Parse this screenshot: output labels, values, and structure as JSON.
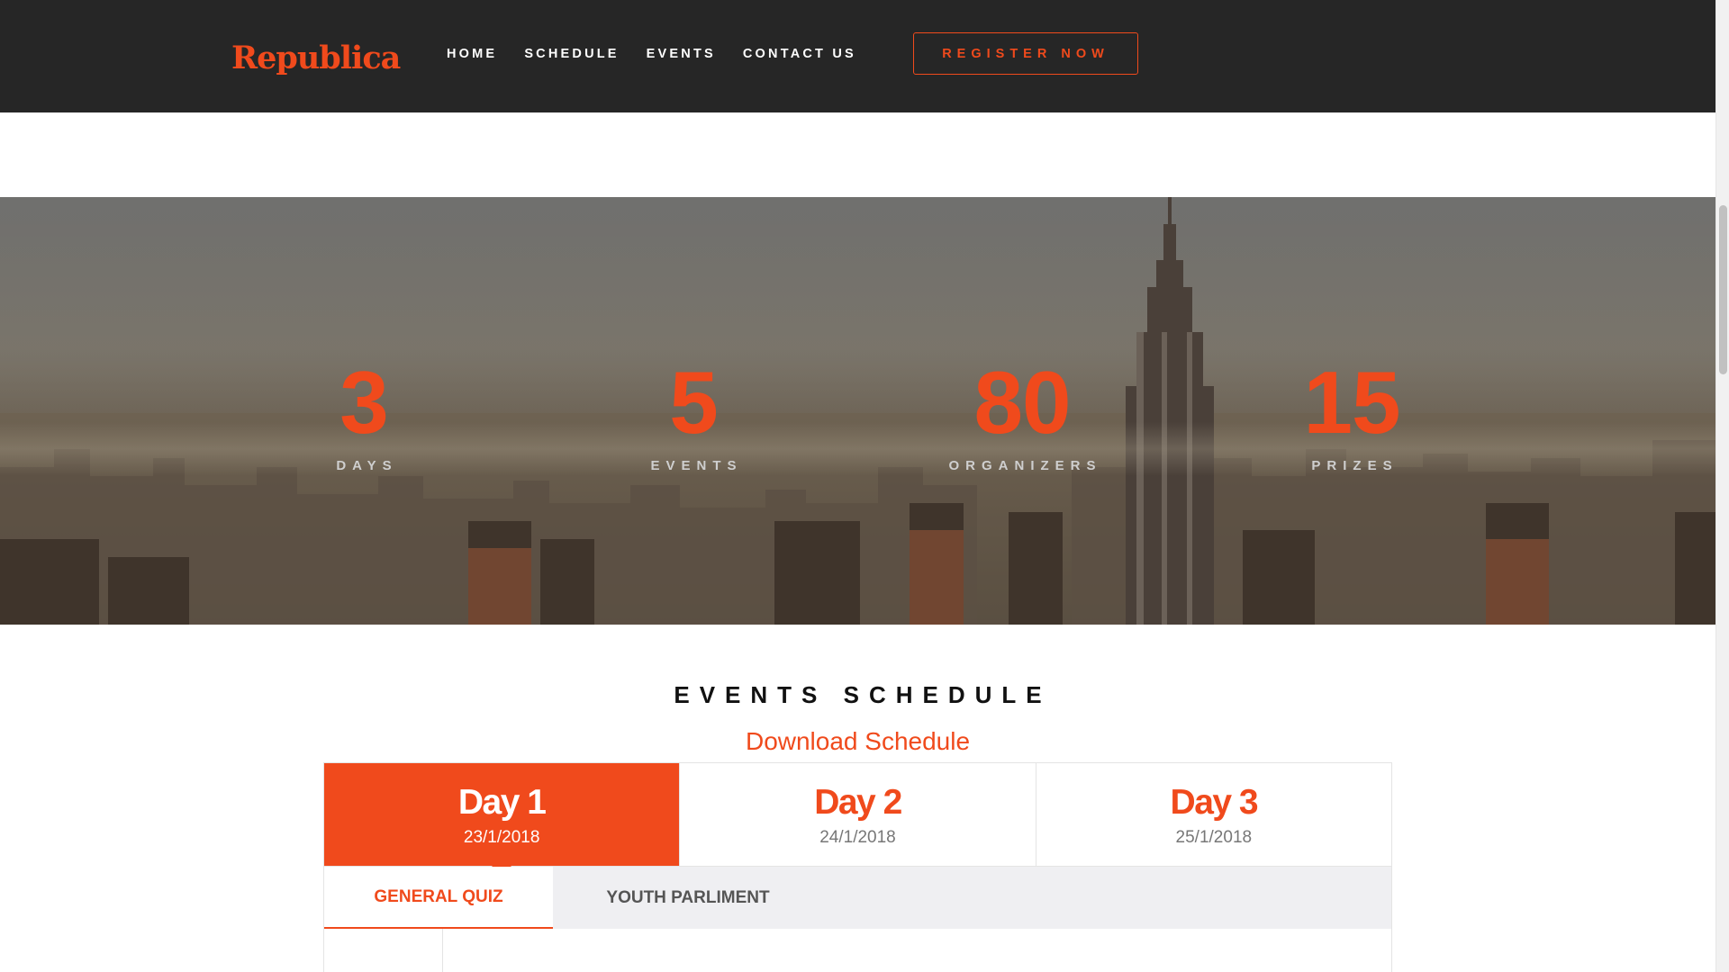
{
  "brand": {
    "logo_text": "Republica",
    "accent": "#f04a1c",
    "dark": "#262626"
  },
  "nav": {
    "items": [
      {
        "label": "HOME"
      },
      {
        "label": "SCHEDULE"
      },
      {
        "label": "EVENTS"
      },
      {
        "label": "CONTACT US"
      }
    ],
    "register_label": "REGISTER NOW"
  },
  "stats": [
    {
      "value": "3",
      "label": "DAYS"
    },
    {
      "value": "5",
      "label": "EVENTS"
    },
    {
      "value": "80",
      "label": "ORGANIZERS"
    },
    {
      "value": "15",
      "label": "PRIZES"
    }
  ],
  "schedule": {
    "title": "EVENTS SCHEDULE",
    "download_label": "Download Schedule",
    "days": [
      {
        "title": "Day 1",
        "date": "23/1/2018",
        "active": true
      },
      {
        "title": "Day 2",
        "date": "24/1/2018",
        "active": false
      },
      {
        "title": "Day 3",
        "date": "25/1/2018",
        "active": false
      }
    ],
    "event_tabs": [
      {
        "label": "GENERAL QUIZ",
        "active": true
      },
      {
        "label": "YOUTH PARLIMENT",
        "active": false
      }
    ]
  }
}
